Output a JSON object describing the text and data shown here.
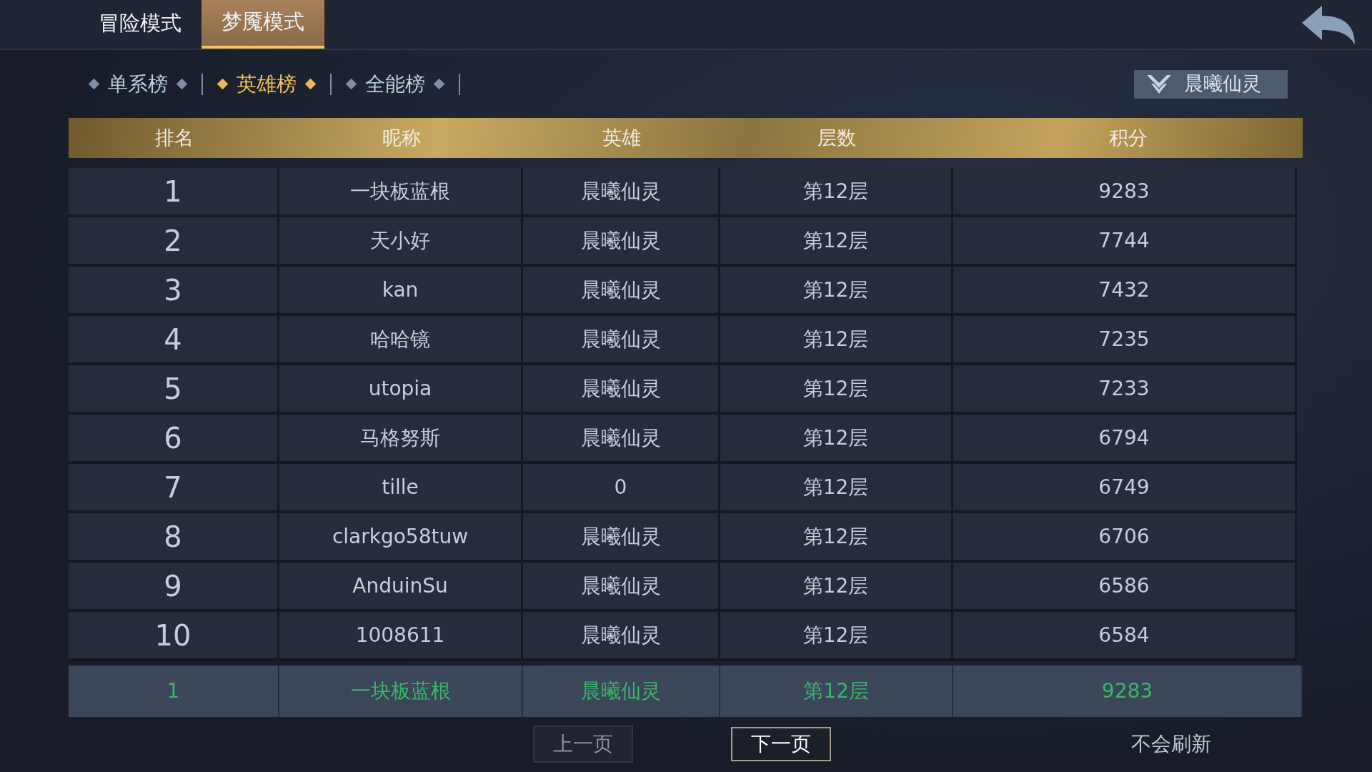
{
  "mode_tabs": [
    {
      "label": "冒险模式",
      "selected": false
    },
    {
      "label": "梦魇模式",
      "selected": true
    }
  ],
  "board_tabs": [
    {
      "label": "单系榜",
      "selected": false
    },
    {
      "label": "英雄榜",
      "selected": true
    },
    {
      "label": "全能榜",
      "selected": false
    }
  ],
  "hero_filter": {
    "value": "晨曦仙灵"
  },
  "table": {
    "columns": [
      "排名",
      "昵称",
      "英雄",
      "层数",
      "积分"
    ],
    "rows": [
      [
        "1",
        "一块板蓝根",
        "晨曦仙灵",
        "第12层",
        "9283"
      ],
      [
        "2",
        "天小好",
        "晨曦仙灵",
        "第12层",
        "7744"
      ],
      [
        "3",
        "kan",
        "晨曦仙灵",
        "第12层",
        "7432"
      ],
      [
        "4",
        "哈哈镜",
        "晨曦仙灵",
        "第12层",
        "7235"
      ],
      [
        "5",
        "utopia",
        "晨曦仙灵",
        "第12层",
        "7233"
      ],
      [
        "6",
        "马格努斯",
        "晨曦仙灵",
        "第12层",
        "6794"
      ],
      [
        "7",
        "tille",
        "0",
        "第12层",
        "6749"
      ],
      [
        "8",
        "clarkgo58tuw",
        "晨曦仙灵",
        "第12层",
        "6706"
      ],
      [
        "9",
        "AnduinSu",
        "晨曦仙灵",
        "第12层",
        "6586"
      ],
      [
        "10",
        "1008611",
        "晨曦仙灵",
        "第12层",
        "6584"
      ]
    ]
  },
  "my_rank": [
    "1",
    "一块板蓝根",
    "晨曦仙灵",
    "第12层",
    "9283"
  ],
  "pagination": [
    {
      "label": "上一页",
      "disabled": true
    },
    {
      "label": "下一页",
      "disabled": false
    }
  ],
  "refresh_note": "不会刷新"
}
